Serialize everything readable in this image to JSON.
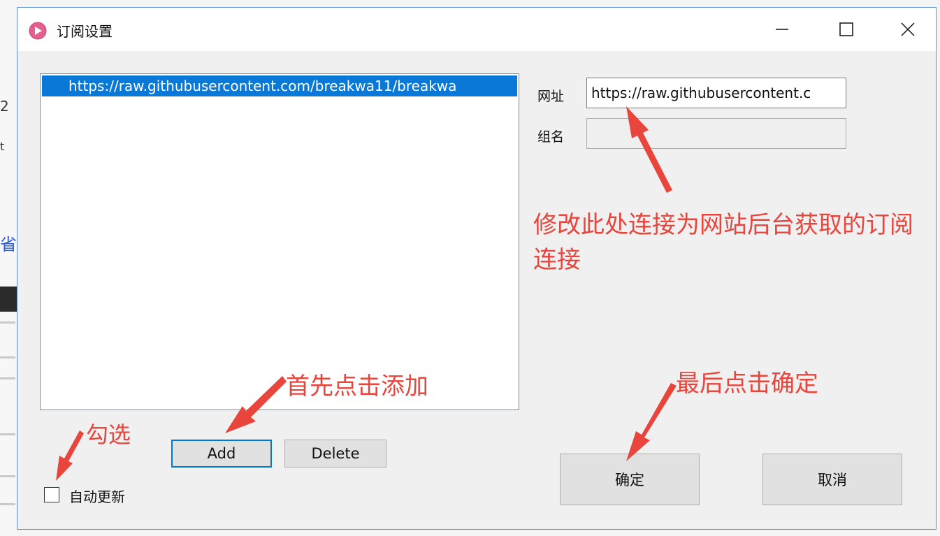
{
  "window": {
    "title": "订阅设置",
    "controls": {
      "minimize": "minimize",
      "maximize": "maximize",
      "close": "close"
    }
  },
  "subscriptions": {
    "items": [
      {
        "url": "https://raw.githubusercontent.com/breakwa11/breakwa",
        "selected": true
      }
    ]
  },
  "form": {
    "url_label": "网址",
    "url_value": "https://raw.githubusercontent.c",
    "group_label": "组名",
    "group_value": ""
  },
  "buttons": {
    "add": "Add",
    "delete": "Delete",
    "ok": "确定",
    "cancel": "取消"
  },
  "auto_update": {
    "label": "自动更新",
    "checked": false
  },
  "annotations": {
    "main": "修改此处连接为网站后台获取的订阅连接",
    "add": "首先点击添加",
    "ok": "最后点击确定",
    "check": "勾选"
  },
  "colors": {
    "selection": "#0a78d7",
    "annotation": "#e8453c",
    "focus_border": "#0078d7",
    "window_border": "#5a8fd6"
  }
}
